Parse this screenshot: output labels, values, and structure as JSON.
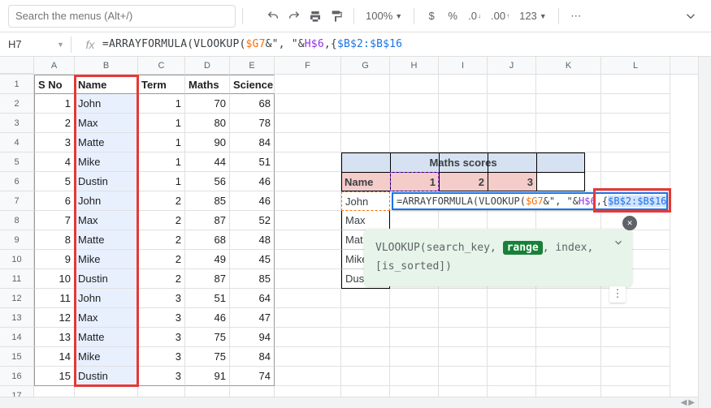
{
  "toolbar": {
    "search_placeholder": "Search the menus (Alt+/)",
    "zoom": "100%",
    "currency": "$",
    "percent": "%",
    "dec_dec": ".0",
    "dec_inc": ".00",
    "num_format": "123",
    "undo_icon": "undo-icon",
    "redo_icon": "redo-icon",
    "print_icon": "print-icon",
    "paint_icon": "paint-format-icon",
    "more_icon": "more-icon",
    "expand_icon": "chevron-down-icon"
  },
  "formula_bar": {
    "name_box": "H7",
    "fx": "fx",
    "prefix": "=ARRAYFORMULA(VLOOKUP(",
    "ref1": "$G7",
    "mid1": "&\", \"&",
    "ref2": "H$6",
    "mid2": ",{",
    "ref3": "$B$2:$B$16"
  },
  "columns": [
    "A",
    "B",
    "C",
    "D",
    "E",
    "F",
    "G",
    "H",
    "I",
    "J",
    "K",
    "L"
  ],
  "row_numbers": [
    1,
    2,
    3,
    4,
    5,
    6,
    7,
    8,
    9,
    10,
    11,
    12,
    13,
    14,
    15,
    16,
    17
  ],
  "table": {
    "headers": {
      "a": "S No",
      "b": "Name",
      "c": "Term",
      "d": "Maths",
      "e": "Science"
    },
    "rows": [
      {
        "sno": 1,
        "name": "John",
        "term": 1,
        "maths": 70,
        "science": 68
      },
      {
        "sno": 2,
        "name": "Max",
        "term": 1,
        "maths": 80,
        "science": 78
      },
      {
        "sno": 3,
        "name": "Matte",
        "term": 1,
        "maths": 90,
        "science": 84
      },
      {
        "sno": 4,
        "name": "Mike",
        "term": 1,
        "maths": 44,
        "science": 51
      },
      {
        "sno": 5,
        "name": "Dustin",
        "term": 1,
        "maths": 56,
        "science": 46
      },
      {
        "sno": 6,
        "name": "John",
        "term": 2,
        "maths": 85,
        "science": 46
      },
      {
        "sno": 7,
        "name": "Max",
        "term": 2,
        "maths": 87,
        "science": 52
      },
      {
        "sno": 8,
        "name": "Matte",
        "term": 2,
        "maths": 68,
        "science": 48
      },
      {
        "sno": 9,
        "name": "Mike",
        "term": 2,
        "maths": 49,
        "science": 45
      },
      {
        "sno": 10,
        "name": "Dustin",
        "term": 2,
        "maths": 87,
        "science": 85
      },
      {
        "sno": 11,
        "name": "John",
        "term": 3,
        "maths": 51,
        "science": 64
      },
      {
        "sno": 12,
        "name": "Max",
        "term": 3,
        "maths": 46,
        "science": 47
      },
      {
        "sno": 13,
        "name": "Matte",
        "term": 3,
        "maths": 75,
        "science": 94
      },
      {
        "sno": 14,
        "name": "Mike",
        "term": 3,
        "maths": 75,
        "science": 84
      },
      {
        "sno": 15,
        "name": "Dustin",
        "term": 3,
        "maths": 91,
        "science": 74
      }
    ]
  },
  "lookup": {
    "title": "Maths scores",
    "col_name": "Name",
    "terms": [
      1,
      2,
      3
    ],
    "names": [
      "John",
      "Max",
      "Mat",
      "Mike",
      "Dus"
    ],
    "names_trunc": {
      "0": "John",
      "1": "Max",
      "2": "Mat",
      "3": "Mike",
      "4": "Dus"
    }
  },
  "cell_formula": {
    "prefix": "=ARRAYFORMULA(VLOOKUP(",
    "ref1": "$G7",
    "mid1": "&\", \"&",
    "ref2": "H$6",
    "mid2": ",{",
    "ref3": "$B$2:$B$16"
  },
  "tooltip": {
    "fn": "VLOOKUP",
    "p1": "search_key",
    "p2": "range",
    "p3": "index",
    "p4": "[is_sorted]"
  }
}
